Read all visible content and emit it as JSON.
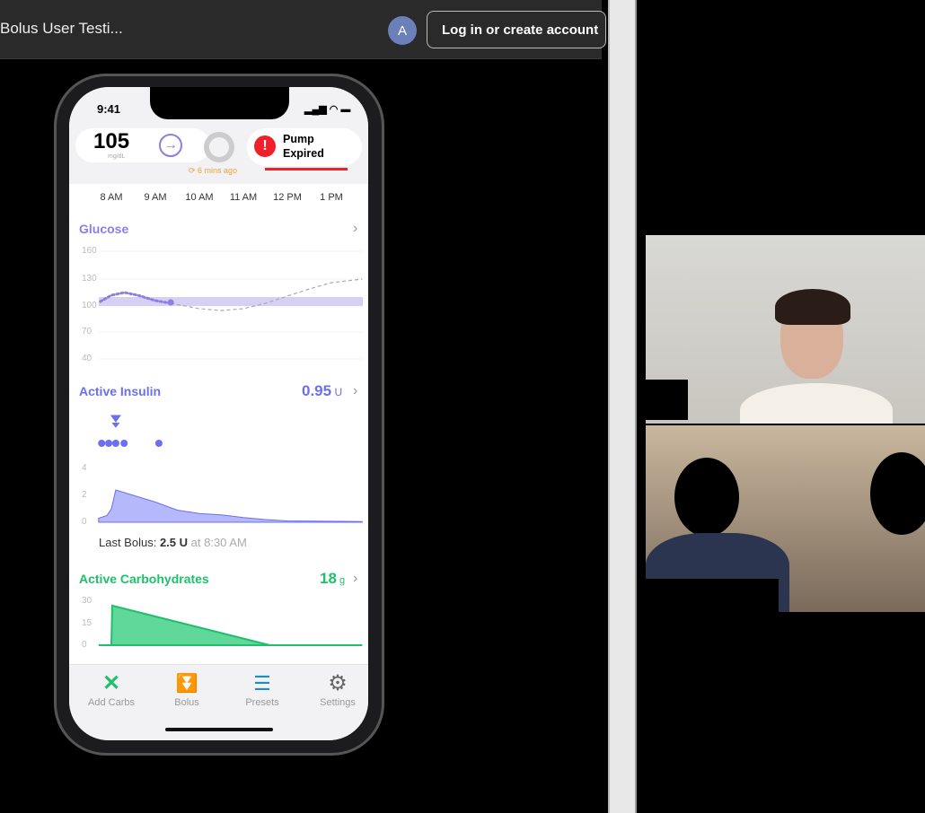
{
  "browser": {
    "title": "Bolus User Testi...",
    "avatar_letter": "A",
    "login_label": "Log in or create account"
  },
  "phone": {
    "status_time": "9:41",
    "glucose_value": "105",
    "glucose_unit": "mg/dL",
    "updated": "6 mins ago",
    "pump_status": "Pump Expired",
    "time_labels": [
      "8 AM",
      "9 AM",
      "10 AM",
      "11 AM",
      "12 PM",
      "1 PM"
    ],
    "glucose": {
      "title": "Glucose",
      "y_ticks": [
        "160",
        "130",
        "100",
        "70",
        "40"
      ],
      "target_range": [
        100,
        110
      ],
      "history": [
        [
          7.75,
          105
        ],
        [
          8.0,
          112
        ],
        [
          8.3,
          115
        ],
        [
          8.6,
          112
        ],
        [
          9.0,
          106
        ],
        [
          9.35,
          103
        ]
      ],
      "current": [
        9.35,
        104
      ],
      "prediction": [
        [
          9.35,
          103
        ],
        [
          10,
          97
        ],
        [
          10.5,
          95
        ],
        [
          11,
          97
        ],
        [
          11.5,
          103
        ],
        [
          12,
          111
        ],
        [
          12.5,
          119
        ],
        [
          13,
          126
        ],
        [
          13.7,
          130
        ]
      ]
    },
    "insulin": {
      "title": "Active Insulin",
      "value": "0.95",
      "unit": "U",
      "y_ticks": [
        "4",
        "2",
        "0"
      ],
      "series": [
        [
          7.71,
          0.3
        ],
        [
          7.9,
          0.5
        ],
        [
          8.0,
          1.0
        ],
        [
          8.1,
          2.4
        ],
        [
          8.5,
          2.0
        ],
        [
          9.0,
          1.5
        ],
        [
          9.5,
          0.9
        ],
        [
          10,
          0.65
        ],
        [
          10.5,
          0.55
        ],
        [
          11,
          0.35
        ],
        [
          11.5,
          0.2
        ],
        [
          12,
          0.1
        ],
        [
          13.7,
          0.05
        ]
      ],
      "bolus_marker": 8.1,
      "doses": [
        7.78,
        7.94,
        8.1,
        8.29,
        9.08
      ],
      "last_bolus_label": "Last Bolus:",
      "last_bolus_value": "2.5 U",
      "last_bolus_time": "at 8:30 AM"
    },
    "carbs": {
      "title": "Active Carbohydrates",
      "value": "18",
      "unit": "g",
      "y_ticks": [
        "30",
        "15",
        "0"
      ],
      "series": [
        [
          7.71,
          0
        ],
        [
          8.0,
          0
        ],
        [
          8.02,
          27
        ],
        [
          11.6,
          0
        ],
        [
          13.7,
          0
        ]
      ]
    },
    "tabs": [
      {
        "label": "Add Carbs",
        "icon": "fork-spoon-icon"
      },
      {
        "label": "Bolus",
        "icon": "bolus-icon"
      },
      {
        "label": "Presets",
        "icon": "sliders-icon"
      },
      {
        "label": "Settings",
        "icon": "gear-icon"
      }
    ]
  },
  "colors": {
    "glucose": "#8b7fe0",
    "insulin": "#6b6ff0",
    "carbs": "#1fbf6e",
    "alert": "#f0202a",
    "updated": "#f0a040"
  }
}
